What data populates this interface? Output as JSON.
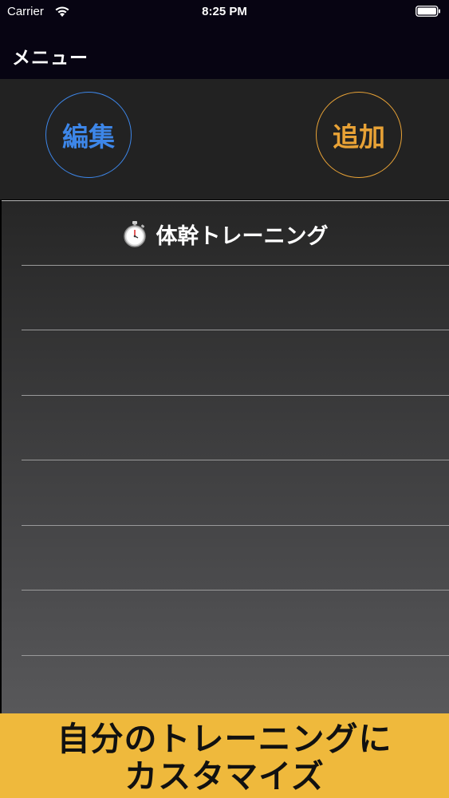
{
  "status_bar": {
    "carrier": "Carrier",
    "time": "8:25 PM",
    "wifi_icon": "wifi-icon",
    "battery_icon": "battery-icon"
  },
  "nav": {
    "title": "メニュー"
  },
  "toolbar": {
    "edit_label": "編集",
    "add_label": "追加",
    "edit_color": "#3d86e8",
    "add_color": "#e8a236"
  },
  "list": {
    "header_icon": "stopwatch-icon",
    "header_title": "体幹トレーニング",
    "rows": [
      "",
      "",
      "",
      "",
      "",
      "",
      ""
    ]
  },
  "banner": {
    "line1": "自分のトレーニングに",
    "line2": "カスタマイズ",
    "background": "#efb93c"
  }
}
